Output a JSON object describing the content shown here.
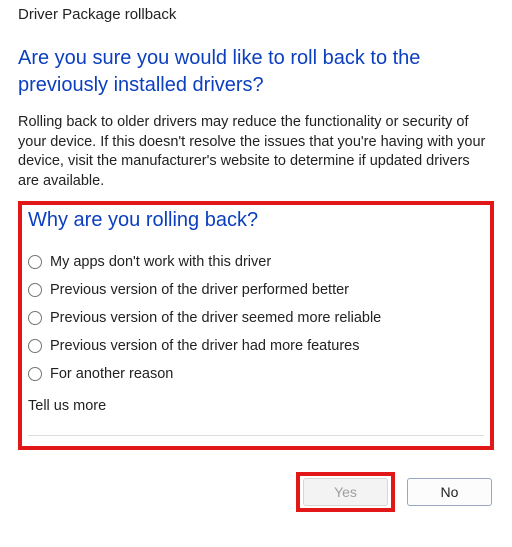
{
  "window_title": "Driver Package rollback",
  "heading": "Are you sure you would like to roll back to the previously installed drivers?",
  "description": "Rolling back to older drivers may reduce the functionality or security of your device. If this doesn't resolve the issues that you're having with your device, visit the manufacturer's website to determine if updated drivers are available.",
  "reason_heading": "Why are you rolling back?",
  "reasons": [
    "My apps don't work with this driver",
    "Previous version of the driver performed better",
    "Previous version of the driver seemed more reliable",
    "Previous version of the driver had more features",
    "For another reason"
  ],
  "tell_us_label": "Tell us more",
  "tell_us_value": "",
  "buttons": {
    "yes": "Yes",
    "no": "No"
  },
  "highlight": {
    "color": "#e21818"
  }
}
